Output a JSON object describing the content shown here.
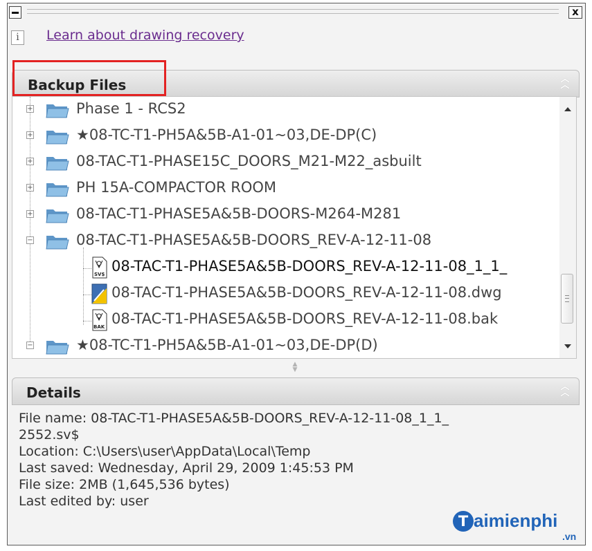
{
  "titlebar": {
    "close_glyph": "x"
  },
  "info": {
    "icon_glyph": "i",
    "link_text": "Learn about drawing recovery"
  },
  "backup": {
    "title": "Backup Files",
    "tree": [
      {
        "label": "Phase 1 - RCS2"
      },
      {
        "label": "★08-TC-T1-PH5A&5B-A1-01~03,DE-DP(C)"
      },
      {
        "label": "08-TAC-T1-PHASE15C_DOORS_M21-M22_asbuilt"
      },
      {
        "label": "PH 15A-COMPACTOR ROOM"
      },
      {
        "label": "08-TAC-T1-PHASE5A&5B-DOORS-M264-M281"
      },
      {
        "label": "08-TAC-T1-PHASE5A&5B-DOORS_REV-A-12-11-08"
      },
      {
        "label": "08-TAC-T1-PHASE5A&5B-DOORS_REV-A-12-11-08_1_1_",
        "badge": "SV$"
      },
      {
        "label": "08-TAC-T1-PHASE5A&5B-DOORS_REV-A-12-11-08.dwg"
      },
      {
        "label": "08-TAC-T1-PHASE5A&5B-DOORS_REV-A-12-11-08.bak",
        "badge": "BAK"
      },
      {
        "label": "★08-TC-T1-PH5A&5B-A1-01~03,DE-DP(D)"
      }
    ]
  },
  "details": {
    "title": "Details",
    "file_name_line1": "File name: 08-TAC-T1-PHASE5A&5B-DOORS_REV-A-12-11-08_1_1_",
    "file_name_line2": "2552.sv$",
    "location": "Location: C:\\Users\\user\\AppData\\Local\\Temp",
    "last_saved": "Last saved: Wednesday, April 29, 2009  1:45:53 PM",
    "file_size": "File size: 2MB (1,645,536 bytes)",
    "last_edited": "Last edited by: user"
  },
  "watermark": {
    "logo_glyph": "T",
    "text": "aimienphi",
    "sub": ".vn"
  },
  "colors": {
    "link": "#6a2c8e",
    "highlight": "#e32222",
    "folder": "#7fb0d9",
    "watermark": "#2164b8"
  }
}
